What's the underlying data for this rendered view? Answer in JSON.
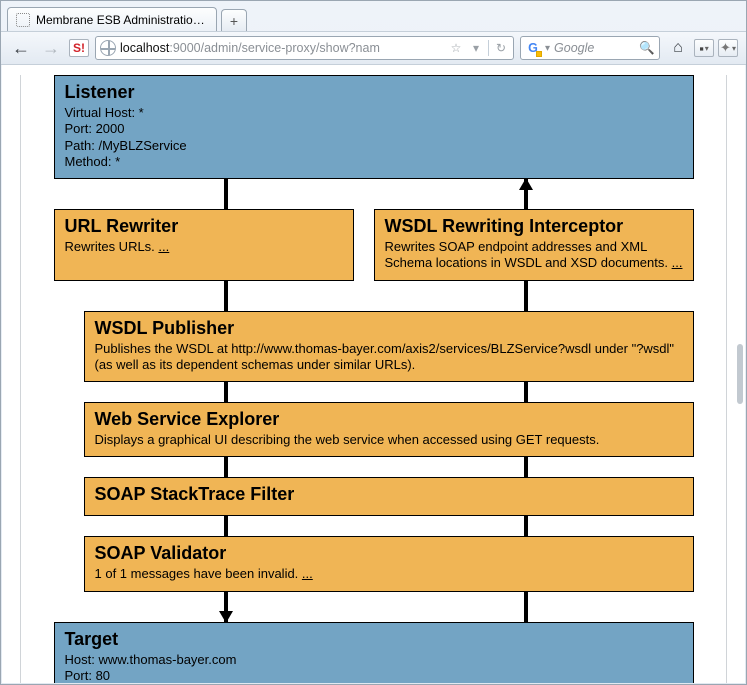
{
  "browser": {
    "tab_title": "Membrane ESB Administration BLZServi...",
    "new_tab_glyph": "+",
    "url_host": "localhost",
    "url_rest": ":9000/admin/service-proxy/show?nam",
    "star_glyph": "☆",
    "dd_glyph": "▾",
    "reload_glyph": "↻",
    "search_placeholder": "Google",
    "back_glyph": "←",
    "fwd_glyph": "→",
    "stylish_glyph": "S!",
    "engine_letter": "G",
    "magnifier_glyph": "🔍",
    "home_glyph": "⌂",
    "bookmark_btn_glyph": "▪",
    "feed_btn_glyph": "✦"
  },
  "listener": {
    "title": "Listener",
    "l1": "Virtual Host: *",
    "l2": "Port: 2000",
    "l3": "Path: /MyBLZService",
    "l4": "Method: *"
  },
  "url_rewriter": {
    "title": "URL Rewriter",
    "desc_prefix": "Rewrites URLs. ",
    "more": "..."
  },
  "wsdl_rewriting": {
    "title": "WSDL Rewriting Interceptor",
    "desc_prefix": "Rewrites SOAP endpoint addresses and XML Schema locations in WSDL and XSD documents. ",
    "more": "..."
  },
  "wsdl_publisher": {
    "title": "WSDL Publisher",
    "desc": "Publishes the WSDL at http://www.thomas-bayer.com/axis2/services/BLZService?wsdl under \"?wsdl\" (as well as its dependent schemas under similar URLs)."
  },
  "ws_explorer": {
    "title": "Web Service Explorer",
    "desc": "Displays a graphical UI describing the web service when accessed using GET requests."
  },
  "soap_stacktrace": {
    "title": "SOAP StackTrace Filter"
  },
  "soap_validator": {
    "title": "SOAP Validator",
    "desc_prefix": "1 of 1 messages have been invalid. ",
    "more": "..."
  },
  "target": {
    "title": "Target",
    "l1": "Host: www.thomas-bayer.com",
    "l2": "Port: 80"
  }
}
